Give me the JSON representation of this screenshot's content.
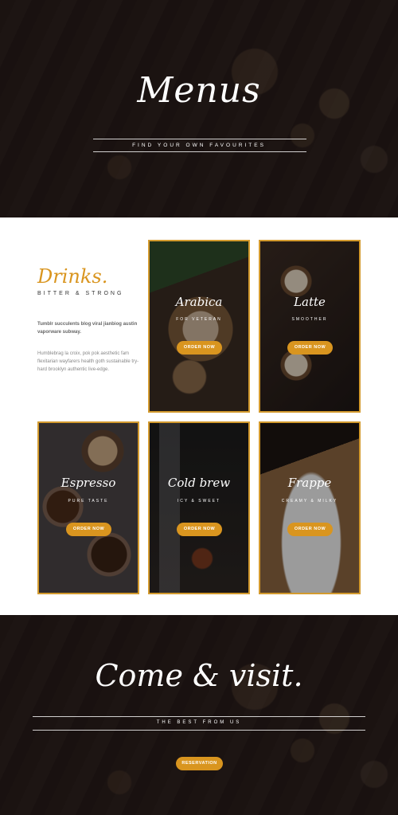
{
  "hero": {
    "title": "Menus",
    "subtitle": "FIND YOUR OWN FAVOURITES"
  },
  "intro": {
    "title": "Drinks.",
    "subtitle": "BITTER & STRONG",
    "bold_text": "Tumblr succulents blog viral jianbiog austin vaporware subway.",
    "body_text": "Humblebrag la croix, pok pok aesthetic fam flexitarian wayfarers health goth sustainable try-hard brooklyn authentic live-edge."
  },
  "cards": [
    {
      "name": "Arabica",
      "tag": "FOR VETERAN",
      "button": "ORDER NOW"
    },
    {
      "name": "Latte",
      "tag": "SMOOTHER",
      "button": "ORDER NOW"
    },
    {
      "name": "Espresso",
      "tag": "PURE TASTE",
      "button": "ORDER NOW"
    },
    {
      "name": "Cold brew",
      "tag": "ICY & SWEET",
      "button": "ORDER NOW"
    },
    {
      "name": "Frappe",
      "tag": "CREAMY & MILKY",
      "button": "ORDER NOW"
    }
  ],
  "visit": {
    "title": "Come & visit.",
    "subtitle": "THE BEST FROM US",
    "button": "RESERVATION"
  },
  "colors": {
    "accent": "#d9951f",
    "card_border": "#d39a2e",
    "dark_bg": "#2a201d"
  }
}
